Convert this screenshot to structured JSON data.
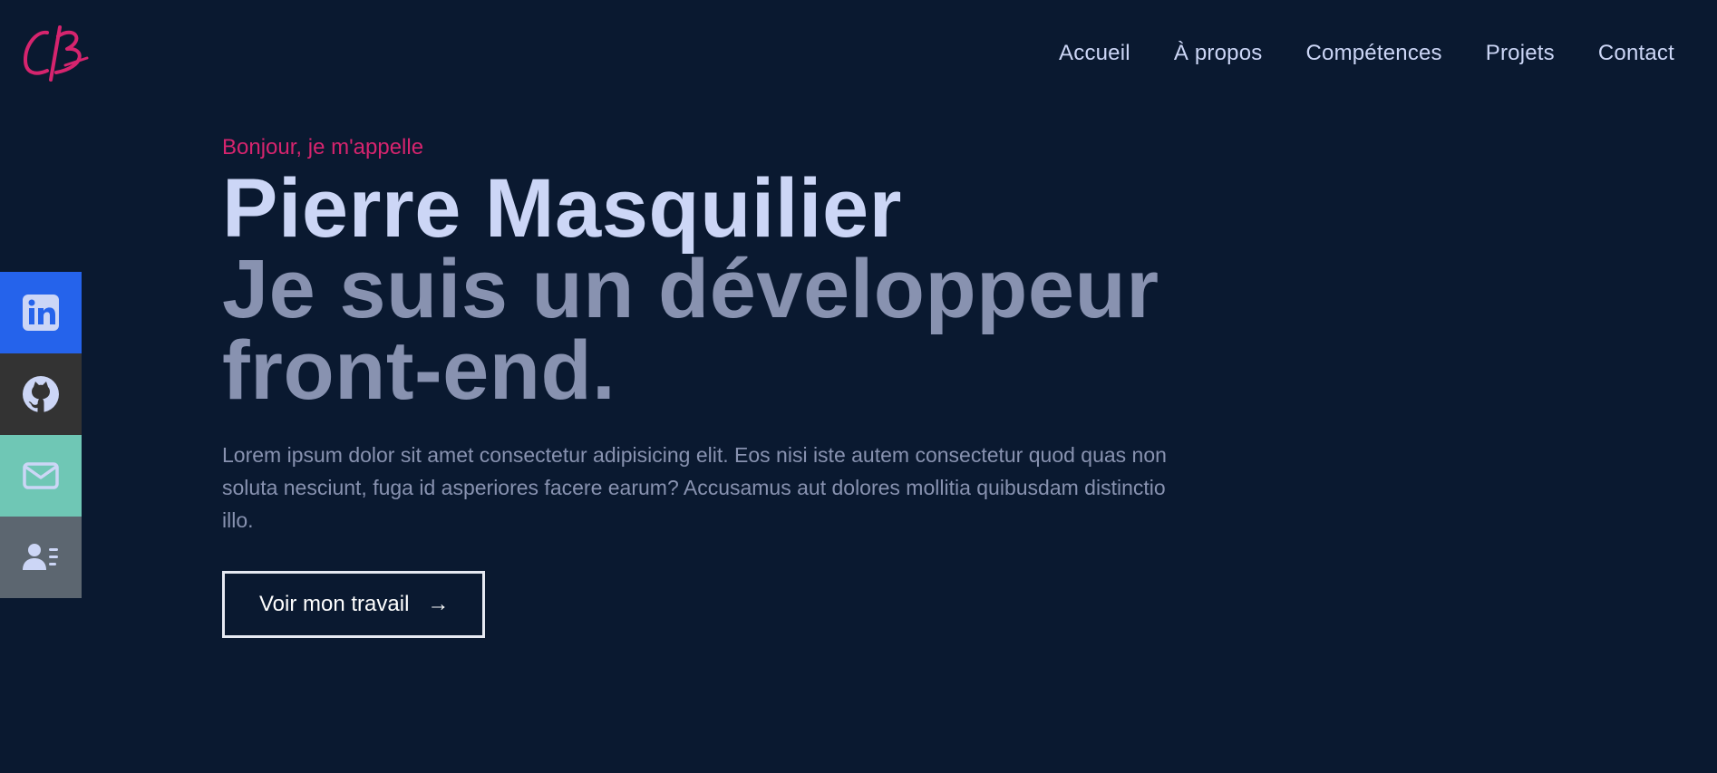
{
  "brand": {
    "logo_text": "CB",
    "accent_color": "#d6246e"
  },
  "nav": {
    "items": [
      "Accueil",
      "À propos",
      "Compétences",
      "Projets",
      "Contact"
    ]
  },
  "social": {
    "icons": [
      "linkedin-icon",
      "github-icon",
      "mail-icon",
      "contact-card-icon"
    ],
    "colors": [
      "#2563eb",
      "#333333",
      "#6fc7b5",
      "#5c6670"
    ]
  },
  "hero": {
    "greeting": "Bonjour, je m'appelle",
    "name": "Pierre Masquilier",
    "tagline": "Je suis un développeur front-end.",
    "description": "Lorem ipsum dolor sit amet consectetur adipisicing elit. Eos nisi iste autem consectetur quod quas non soluta nesciunt, fuga id asperiores facere earum? Accusamus aut dolores mollitia quibusdam distinctio illo.",
    "cta_label": "Voir mon travail",
    "cta_icon": "arrow-right-icon"
  },
  "colors": {
    "background": "#0a1930",
    "heading": "#ccd6f6",
    "muted": "#8892b0"
  }
}
